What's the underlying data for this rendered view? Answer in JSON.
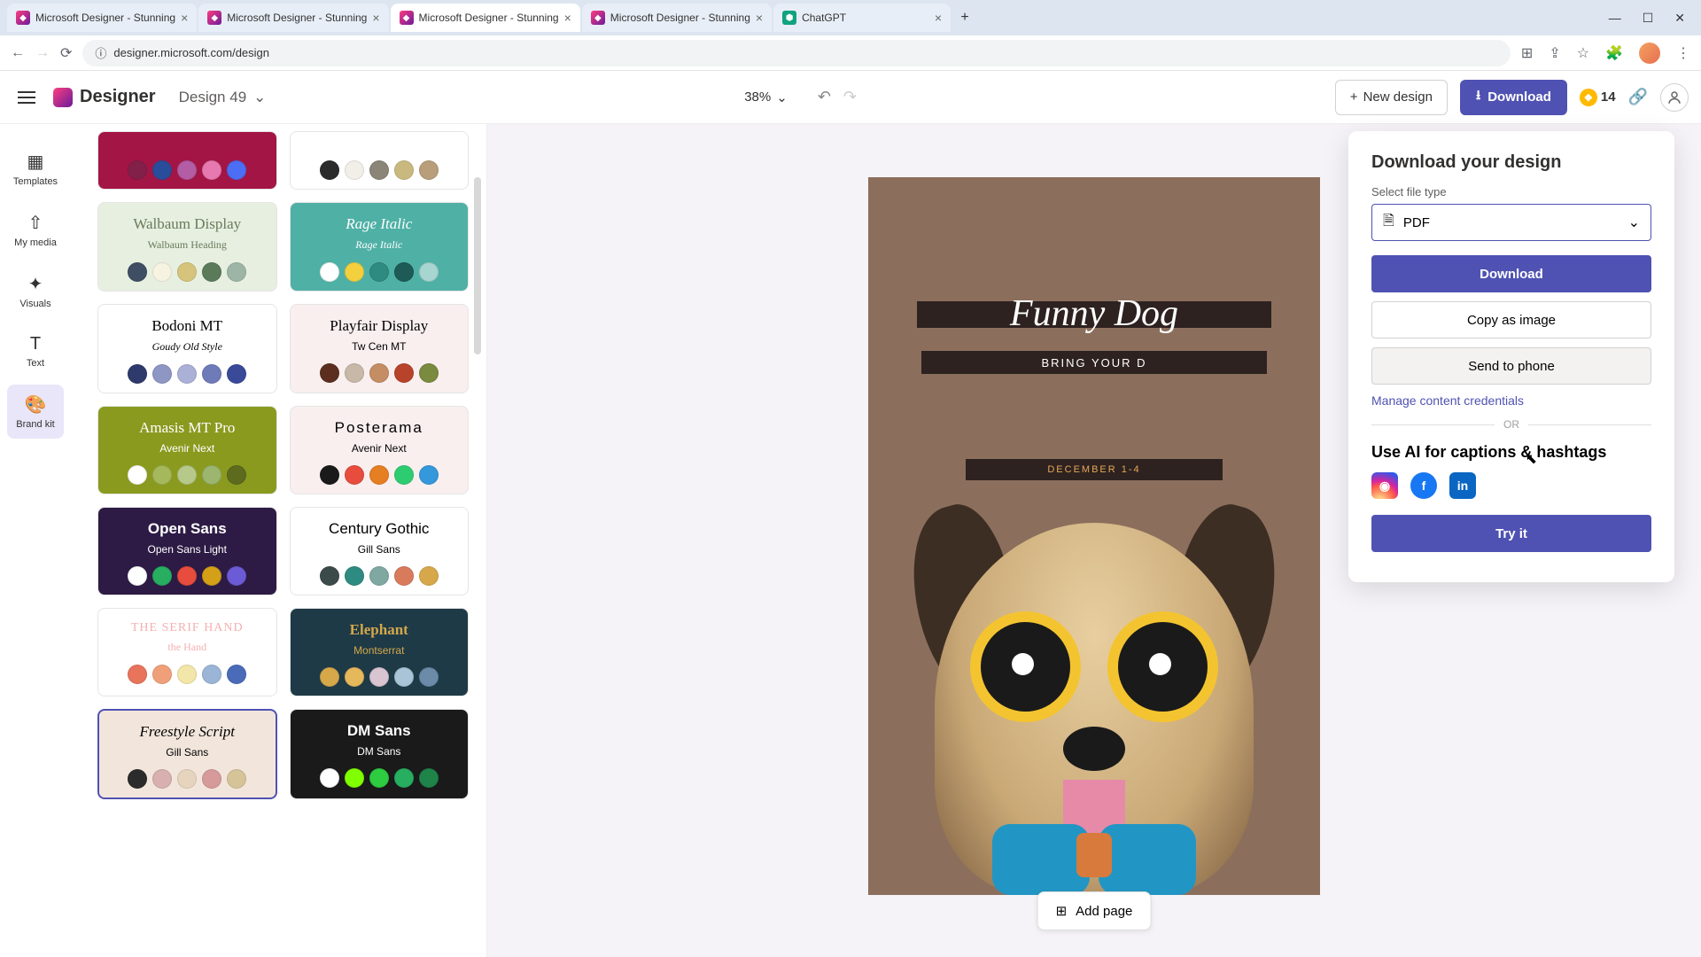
{
  "browser": {
    "tabs": [
      {
        "title": "Microsoft Designer - Stunning",
        "active": false
      },
      {
        "title": "Microsoft Designer - Stunning",
        "active": false
      },
      {
        "title": "Microsoft Designer - Stunning",
        "active": true
      },
      {
        "title": "Microsoft Designer - Stunning",
        "active": false
      },
      {
        "title": "ChatGPT",
        "active": false,
        "plain": true
      }
    ],
    "url": "designer.microsoft.com/design"
  },
  "header": {
    "logo": "Designer",
    "design_name": "Design 49",
    "zoom": "38%",
    "new_design": "New design",
    "download": "Download",
    "credits": "14"
  },
  "sidenav": {
    "templates": "Templates",
    "mymedia": "My media",
    "visuals": "Visuals",
    "text": "Text",
    "brandkit": "Brand kit"
  },
  "brand_cards": [
    {
      "bg": "#a31545",
      "font1": "",
      "font2": "",
      "f1style": "",
      "f2style": "",
      "tcolor": "#fff",
      "palette": [
        "#82204a",
        "#2a4d9b",
        "#b35da5",
        "#e67ab0",
        "#4c6ef5"
      ]
    },
    {
      "bg": "#ffffff",
      "font1": "",
      "font2": "",
      "f1style": "",
      "f2style": "",
      "tcolor": "#333",
      "palette": [
        "#2b2b2b",
        "#f2efe9",
        "#8a8577",
        "#c9b97e",
        "#b89e7a"
      ]
    },
    {
      "bg": "#e6efe0",
      "font1": "Walbaum Display",
      "font2": "Walbaum Heading",
      "f1style": "font-family:Georgia,serif;color:#6b7a5a",
      "f2style": "font-family:Georgia,serif;color:#6b7a5a",
      "tcolor": "#6b7a5a",
      "palette": [
        "#3f4e63",
        "#f6f3e1",
        "#d6c47c",
        "#5b7a5a",
        "#9cb5a6"
      ]
    },
    {
      "bg": "#4fb0a5",
      "font1": "Rage Italic",
      "font2": "Rage Italic",
      "f1style": "font-family:'Brush Script MT',cursive;font-style:italic;color:#fff",
      "f2style": "font-family:'Brush Script MT',cursive;font-style:italic;color:#fff",
      "tcolor": "#fff",
      "palette": [
        "#ffffff",
        "#f4d03f",
        "#2e8b82",
        "#1e5a56",
        "#a8d5cf"
      ]
    },
    {
      "bg": "#ffffff",
      "font1": "Bodoni MT",
      "font2": "Goudy Old Style",
      "f1style": "font-family:'Bodoni MT',Georgia,serif",
      "f2style": "font-family:Georgia,serif;font-style:italic",
      "tcolor": "#333",
      "palette": [
        "#2e3a6b",
        "#8e96c4",
        "#aab0d6",
        "#6f7bb8",
        "#3a4a99"
      ]
    },
    {
      "bg": "#f9efef",
      "font1": "Playfair Display",
      "font2": "Tw Cen MT",
      "f1style": "font-family:Georgia,serif",
      "f2style": "font-family:Arial,sans-serif",
      "tcolor": "#333",
      "palette": [
        "#5c2e1f",
        "#c7b8a8",
        "#c48d63",
        "#b8432b",
        "#7a8a3f"
      ]
    },
    {
      "bg": "#8a9a1f",
      "font1": "Amasis MT Pro",
      "font2": "Avenir Next",
      "f1style": "font-family:Georgia,serif;color:#fff",
      "f2style": "color:#fff",
      "tcolor": "#fff",
      "palette": [
        "#ffffff",
        "#a6b85c",
        "#b6c98a",
        "#9cb56f",
        "#5d6b1f"
      ]
    },
    {
      "bg": "#f9efef",
      "font1": "Posterama",
      "font2": "Avenir Next",
      "f1style": "font-family:Arial,sans-serif;letter-spacing:2px",
      "f2style": "",
      "tcolor": "#333",
      "palette": [
        "#1a1a1a",
        "#e74c3c",
        "#e67e22",
        "#2ecc71",
        "#3498db"
      ]
    },
    {
      "bg": "#2d1b45",
      "font1": "Open Sans",
      "font2": "Open Sans Light",
      "f1style": "color:#fff;font-weight:600",
      "f2style": "color:#fff;font-weight:300",
      "tcolor": "#fff",
      "palette": [
        "#ffffff",
        "#27ae60",
        "#e74c3c",
        "#d4a017",
        "#6b5bd6"
      ]
    },
    {
      "bg": "#ffffff",
      "font1": "Century Gothic",
      "font2": "Gill Sans",
      "f1style": "font-family:Arial,sans-serif;font-weight:300",
      "f2style": "",
      "tcolor": "#333",
      "palette": [
        "#3d4a4a",
        "#2e8b82",
        "#7fa8a3",
        "#d87a5c",
        "#d6a84a"
      ]
    },
    {
      "bg": "#ffffff",
      "font1": "THE SERIF HAND",
      "font2": "the Hand",
      "f1style": "font-family:cursive;color:#f5b0b0;letter-spacing:1px;font-size:14px",
      "f2style": "font-family:cursive;color:#f5b0b0",
      "tcolor": "#f5b0b0",
      "palette": [
        "#e8745c",
        "#f0a078",
        "#f2e6a8",
        "#9bb5d6",
        "#4a6bb8"
      ]
    },
    {
      "bg": "#1e3a47",
      "font1": "Elephant",
      "font2": "Montserrat",
      "f1style": "font-family:Georgia,serif;font-weight:bold;color:#d4a84a",
      "f2style": "color:#d4a84a",
      "tcolor": "#d4a84a",
      "palette": [
        "#d6a84a",
        "#e6b85c",
        "#d9c4d1",
        "#a8c4d6",
        "#6b8ba8"
      ]
    },
    {
      "bg": "#f2e6dc",
      "font1": "Freestyle Script",
      "font2": "Gill Sans",
      "f1style": "font-family:'Brush Script MT',cursive;font-style:italic",
      "f2style": "",
      "tcolor": "#333",
      "selected": true,
      "palette": [
        "#2b2b2b",
        "#d9b0b0",
        "#e6d4bf",
        "#d69a9a",
        "#d6c499"
      ]
    },
    {
      "bg": "#1a1a1a",
      "font1": "DM Sans",
      "font2": "DM Sans",
      "f1style": "color:#fff;font-weight:600",
      "f2style": "color:#fff",
      "tcolor": "#fff",
      "palette": [
        "#ffffff",
        "#7fff00",
        "#2ecc40",
        "#27ae60",
        "#1e8449"
      ]
    }
  ],
  "canvas": {
    "title": "Funny Dog",
    "subtitle": "BRING YOUR D",
    "date": "DECEMBER 1-4"
  },
  "add_page": "Add page",
  "download_popup": {
    "title": "Download your design",
    "select_label": "Select file type",
    "file_type": "PDF",
    "download": "Download",
    "copy": "Copy as image",
    "send": "Send to phone",
    "credentials": "Manage content credentials",
    "or": "OR",
    "ai_title": "Use AI for captions & hashtags",
    "try": "Try it"
  }
}
